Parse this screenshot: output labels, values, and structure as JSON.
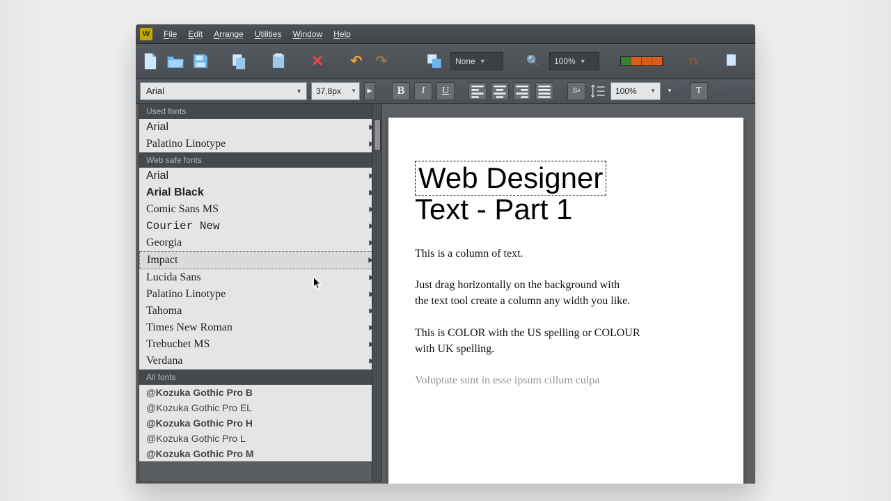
{
  "menubar": {
    "items": [
      "File",
      "Edit",
      "Arrange",
      "Utilities",
      "Window",
      "Help"
    ]
  },
  "toolbar": {
    "view_mode": "None",
    "zoom": "100%"
  },
  "text_toolbar": {
    "font_name": "Arial",
    "font_size": "37,8px",
    "line_height_pct": "100%"
  },
  "font_dd": {
    "section1": "Used fonts",
    "used": [
      "Arial",
      "Palatino Linotype"
    ],
    "section2": "Web safe fonts",
    "safe": [
      "Arial",
      "Arial Black",
      "Comic Sans MS",
      "Courier New",
      "Georgia",
      "Impact",
      "Lucida Sans",
      "Palatino Linotype",
      "Tahoma",
      "Times New Roman",
      "Trebuchet MS",
      "Verdana"
    ],
    "section3": "All fonts",
    "all": [
      "@Kozuka Gothic Pro B",
      "@Kozuka Gothic Pro EL",
      "@Kozuka Gothic Pro H",
      "@Kozuka Gothic Pro L",
      "@Kozuka Gothic Pro M"
    ],
    "selected_index": 5
  },
  "page": {
    "h1": "Web Designer",
    "h2": "Text - Part 1",
    "p1": "This is a column of text.",
    "p2": "Just drag horizontally on the background with\nthe text tool create a column any width you like.",
    "p3": "This is COLOR with the US spelling or COLOUR with UK spelling.",
    "p4": "Voluptate  sunt in esse ipsum cillum culpa"
  }
}
